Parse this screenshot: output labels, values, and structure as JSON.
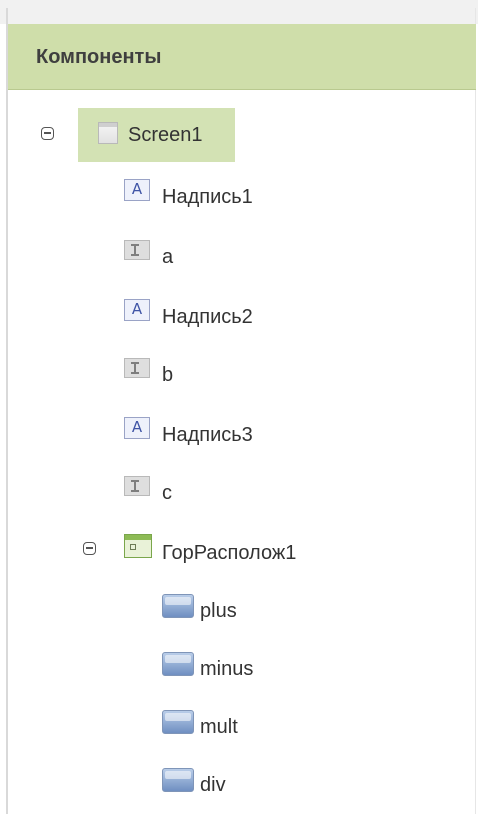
{
  "panel": {
    "title": "Компоненты"
  },
  "tree": {
    "screen": {
      "label": "Screen1",
      "icon": "screen-icon"
    },
    "items": [
      {
        "label": "Надпись1",
        "icon": "label-icon"
      },
      {
        "label": "a",
        "icon": "textbox-icon"
      },
      {
        "label": "Надпись2",
        "icon": "label-icon"
      },
      {
        "label": "b",
        "icon": "textbox-icon"
      },
      {
        "label": "Надпись3",
        "icon": "label-icon"
      },
      {
        "label": "c",
        "icon": "textbox-icon"
      }
    ],
    "layout": {
      "label": "ГорРасполож1",
      "icon": "horizontal-arrangement-icon"
    },
    "buttons": [
      {
        "label": "plus",
        "icon": "button-icon"
      },
      {
        "label": "minus",
        "icon": "button-icon"
      },
      {
        "label": "mult",
        "icon": "button-icon"
      },
      {
        "label": "div",
        "icon": "button-icon"
      }
    ]
  },
  "colors": {
    "header_bg": "#cfdeaa",
    "selected_bg": "#d3e2b4"
  }
}
